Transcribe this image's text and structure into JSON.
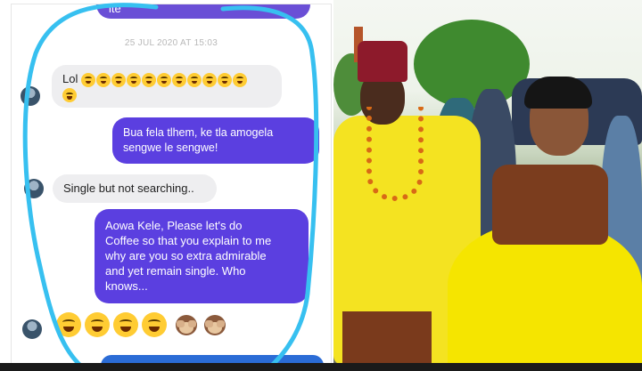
{
  "chat": {
    "top_label": "ite",
    "timestamp": "25 JUL 2020 AT 15:03",
    "messages": [
      {
        "from": "them",
        "text": "Lol"
      },
      {
        "from": "me",
        "line1": "Bua fela tlhem, ke tla amogela",
        "line2": "sengwe le sengwe!"
      },
      {
        "from": "them",
        "text": "Single but not searching.."
      },
      {
        "from": "me",
        "line1": "Aowa Kele, Please let's do",
        "line2": "Coffee so that you explain to me",
        "line3": "why are you so extra admirable",
        "line4": "and yet remain single. Who",
        "line5": "knows..."
      }
    ]
  },
  "colors": {
    "bubble_out": "#5b3fe0",
    "bubble_in": "#eeeef0",
    "scribble": "#37c0f0"
  },
  "icons": {
    "laugh_emoji": "laughing-face-emoji",
    "tongue_emoji": "tongue-out-emoji",
    "monkey_emoji": "see-no-evil-monkey-emoji"
  }
}
